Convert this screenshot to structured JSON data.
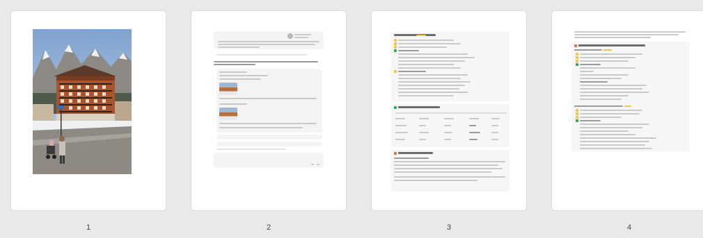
{
  "pages": [
    {
      "number": "1",
      "thumbnail": "hotel-photo"
    },
    {
      "number": "2",
      "thumbnail": "chat-transcript"
    },
    {
      "number": "3",
      "thumbnail": "hotel-comparison"
    },
    {
      "number": "4",
      "thumbnail": "hotel-recommendations"
    }
  ],
  "colors": {
    "background": "#e9e9e9",
    "page": "#ffffff",
    "highlight": "#f4c542",
    "check": "#3aa757"
  }
}
